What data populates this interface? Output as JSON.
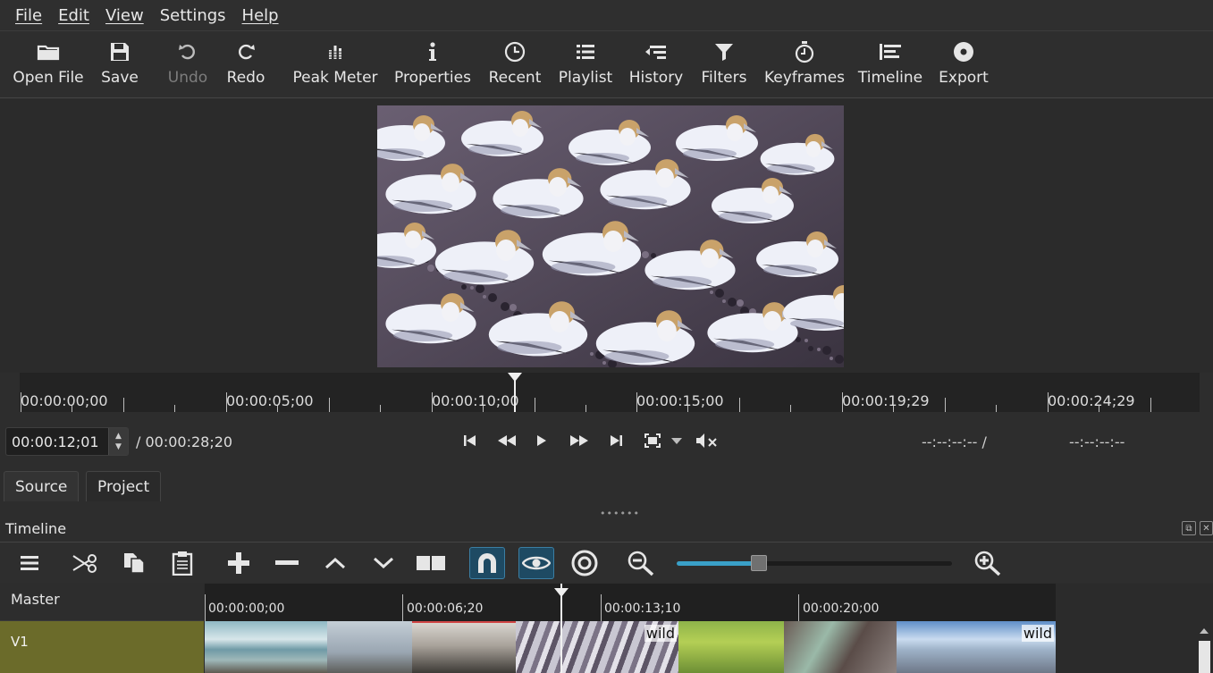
{
  "menu": [
    "File",
    "Edit",
    "View",
    "Settings",
    "Help"
  ],
  "toolbar": {
    "open_file": "Open File",
    "save": "Save",
    "undo": "Undo",
    "redo": "Redo",
    "peak_meter": "Peak Meter",
    "properties": "Properties",
    "recent": "Recent",
    "playlist": "Playlist",
    "history": "History",
    "filters": "Filters",
    "keyframes": "Keyframes",
    "timeline": "Timeline",
    "export": "Export"
  },
  "ruler": {
    "labels": [
      "00:00:00;00",
      "00:00:05;00",
      "00:00:10;00",
      "00:00:15;00",
      "00:00:19;29",
      "00:00:24;29"
    ]
  },
  "transport": {
    "current_time": "00:00:12;01",
    "total_duration": "/ 00:00:28;20",
    "in_point": "--:--:--:-- /",
    "out_point": "--:--:--:--"
  },
  "tabs": {
    "source": "Source",
    "project": "Project"
  },
  "timeline": {
    "title": "Timeline",
    "zoom_level": 0.3,
    "master_label": "Master",
    "track_v1": "V1",
    "ruler_labels": [
      "00:00:00;00",
      "00:00:06;20",
      "00:00:13;10",
      "00:00:20;00"
    ],
    "clips": [
      {
        "label": "wild"
      },
      {
        "label": "wild"
      }
    ]
  },
  "colors": {
    "accent": "#3aa0c8",
    "track_v1": "#6b6b2a",
    "toggle_on": "#1e4a63"
  }
}
